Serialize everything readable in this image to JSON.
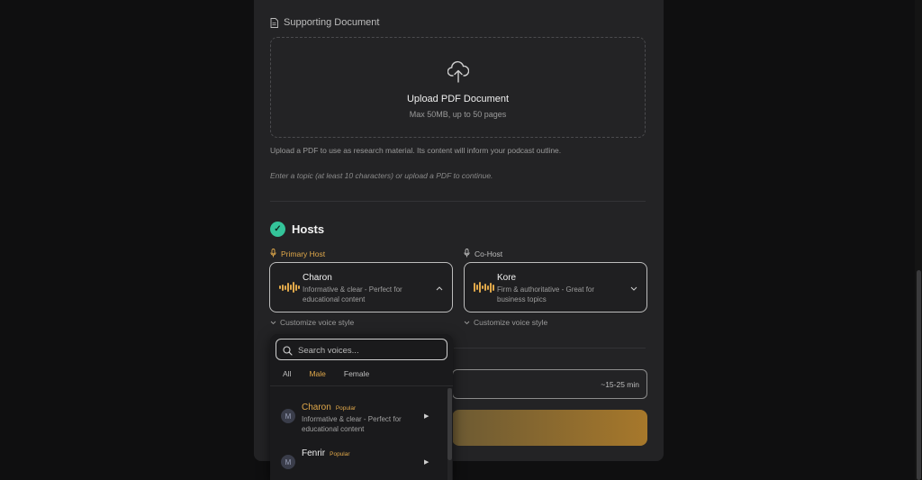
{
  "document_section": {
    "label": "Supporting Document",
    "upload_title": "Upload PDF Document",
    "upload_subtitle": "Max 50MB, up to 50 pages",
    "help_text": "Upload a PDF to use as research material. Its content will inform your podcast outline.",
    "hint_text": "Enter a topic (at least 10 characters) or upload a PDF to continue."
  },
  "hosts": {
    "title": "Hosts",
    "primary": {
      "role_label": "Primary Host",
      "name": "Charon",
      "description": "Informative & clear - Perfect for educational content",
      "customize_label": "Customize voice style"
    },
    "cohost": {
      "role_label": "Co-Host",
      "name": "Kore",
      "description": "Firm & authoritative - Great for business topics",
      "customize_label": "Customize voice style"
    }
  },
  "duration": {
    "value": "~15-25 min"
  },
  "voice_dropdown": {
    "search_placeholder": "Search voices...",
    "filters": [
      "All",
      "Male",
      "Female"
    ],
    "active_filter": "Male",
    "voices": [
      {
        "initial": "M",
        "name": "Charon",
        "badge": "Popular",
        "description": "Informative & clear - Perfect for educational content",
        "selected": true
      },
      {
        "initial": "M",
        "name": "Fenrir",
        "badge": "Popular",
        "description": "",
        "selected": false
      }
    ]
  },
  "colors": {
    "accent": "#e0a84a",
    "success": "#34c49a",
    "panel": "#232325",
    "background": "#0f0f10"
  }
}
